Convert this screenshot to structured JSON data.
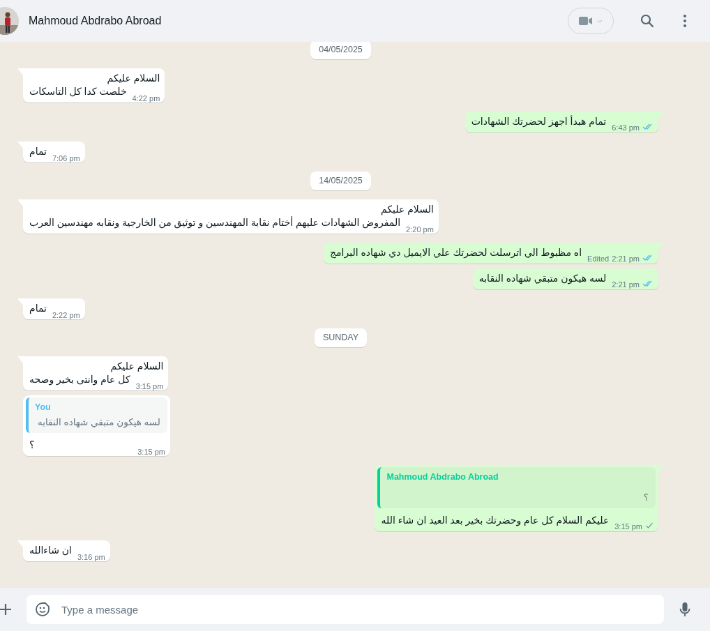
{
  "header": {
    "contact_name": "Mahmoud Abdrabo Abroad"
  },
  "messages": [
    {
      "kind": "date",
      "label": "04/05/2025"
    },
    {
      "kind": "incoming",
      "lines": [
        "السلام عليكم",
        "خلصت كدا كل التاسكات"
      ],
      "time": "4:22 pm"
    },
    {
      "kind": "outgoing",
      "lines": [
        "تمام هبدأ اجهز لحضرتك الشهادات"
      ],
      "time": "6:43 pm",
      "read": true
    },
    {
      "kind": "incoming",
      "lines": [
        "تمام"
      ],
      "time": "7:06 pm"
    },
    {
      "kind": "date",
      "label": "14/05/2025"
    },
    {
      "kind": "incoming",
      "lines": [
        "السلام عليكم",
        "المفروض الشهادات عليهم أختام نقابة المهندسين و توثيق من الخارجية ونقابه مهندسين العرب"
      ],
      "time": "2:20 pm"
    },
    {
      "kind": "outgoing",
      "lines": [
        "اه مظبوط الي اترسلت لحضرتك علي الايميل دي شهاده  البرامج"
      ],
      "time": "2:21 pm",
      "read": true,
      "edited_label": "Edited"
    },
    {
      "kind": "outgoing",
      "lines": [
        "لسه هيكون متبقي شهاده النقابه"
      ],
      "time": "2:21 pm",
      "read": true
    },
    {
      "kind": "incoming",
      "lines": [
        "تمام"
      ],
      "time": "2:22 pm"
    },
    {
      "kind": "date",
      "label": "SUNDAY"
    },
    {
      "kind": "incoming",
      "lines": [
        "السلام عليكم",
        "كل عام وانتى بخير وصحه"
      ],
      "time": "3:15 pm"
    },
    {
      "kind": "incoming",
      "quote": {
        "author": "You",
        "text": "لسه هيكون متبقي شهاده النقابه"
      },
      "lines": [
        "؟"
      ],
      "time": "3:15 pm"
    },
    {
      "kind": "outgoing",
      "quote": {
        "author": "Mahmoud Abdrabo Abroad",
        "text": "؟"
      },
      "lines": [
        "عليكم السلام كل عام وحضرتك بخير بعد العيد ان شاء الله"
      ],
      "time": "3:15 pm",
      "read": false
    },
    {
      "kind": "incoming",
      "lines": [
        "ان شاءالله"
      ],
      "time": "3:16 pm"
    }
  ],
  "composer": {
    "placeholder": "Type a message"
  }
}
